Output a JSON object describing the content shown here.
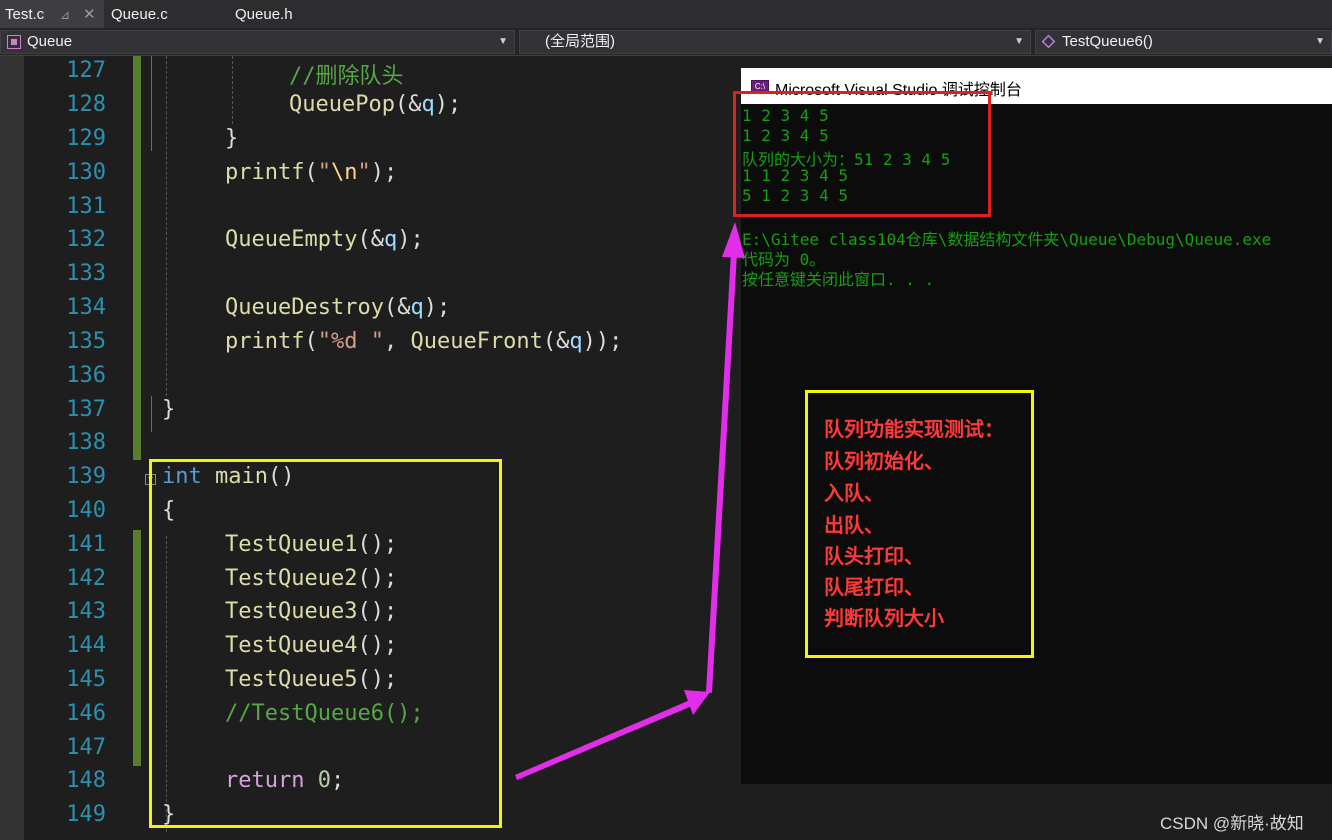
{
  "tabs": [
    {
      "label": "Test.c",
      "active": true
    },
    {
      "label": "Queue.c",
      "active": false
    },
    {
      "label": "Queue.h",
      "active": false
    }
  ],
  "tab_pin_glyph": "⊿",
  "tab_close_glyph": "✕",
  "nav": {
    "project": "Queue",
    "scope": "(全局范围)",
    "member": "TestQueue6()"
  },
  "editor": {
    "line_numbers": [
      "127",
      "128",
      "129",
      "130",
      "131",
      "132",
      "133",
      "134",
      "135",
      "136",
      "137",
      "138",
      "139",
      "140",
      "141",
      "142",
      "143",
      "144",
      "145",
      "146",
      "147",
      "148",
      "149"
    ],
    "code": {
      "l127": "//删除队头",
      "l128_fn": "QueuePop",
      "l128_open": "(&",
      "l128_var": "q",
      "l128_close": ");",
      "l129": "}",
      "l130_fn": "printf",
      "l130_open": "(",
      "l130_q1": "\"",
      "l130_esc": "\\n",
      "l130_q2": "\"",
      "l130_close": ");",
      "l132_fn": "QueueEmpty",
      "l132_open": "(&",
      "l132_var": "q",
      "l132_close": ");",
      "l134_fn": "QueueDestroy",
      "l134_open": "(&",
      "l134_var": "q",
      "l134_close": ");",
      "l135_fn": "printf",
      "l135_open": "(",
      "l135_str": "\"%d \"",
      "l135_comma": ", ",
      "l135_fn2": "QueueFront",
      "l135_open2": "(&",
      "l135_var": "q",
      "l135_close": "));",
      "l137": "}",
      "l139_kw": "int",
      "l139_fn": "main",
      "l139_paren": "()",
      "l140": "{",
      "l141_fn": "TestQueue1",
      "l141_rest": "();",
      "l142_fn": "TestQueue2",
      "l142_rest": "();",
      "l143_fn": "TestQueue3",
      "l143_rest": "();",
      "l144_fn": "TestQueue4",
      "l144_rest": "();",
      "l145_fn": "TestQueue5",
      "l145_rest": "();",
      "l146": "//TestQueue6();",
      "l148_kw": "return",
      "l148_num": "0",
      "l148_semi": ";",
      "l149": "}"
    },
    "fold_glyph": "−"
  },
  "console": {
    "icon_text": "C:\\",
    "title": "Microsoft Visual Studio 调试控制台",
    "lines": [
      "1 2 3 4 5",
      "1 2 3 4 5",
      "队列的大小为：51 2 3 4 5",
      "1 1 2 3 4 5",
      "5 1 2 3 4 5",
      "",
      "E:\\Gitee class104仓库\\数据结构文件夹\\Queue\\Debug\\Queue.exe",
      "代码为 0。",
      "按任意键关闭此窗口. . ."
    ]
  },
  "annotation": {
    "lines": [
      "队列功能实现测试：",
      "队列初始化、",
      "入队、",
      "出队、",
      "队头打印、",
      "队尾打印、",
      "判断队列大小"
    ]
  },
  "colors": {
    "red_box": "#e02020",
    "yellow_box": "#f5f500",
    "arrow": "#e22ee8",
    "console_text": "#13a10e",
    "annotation_text": "#ff3838"
  },
  "watermark": "CSDN @新晓·故知"
}
